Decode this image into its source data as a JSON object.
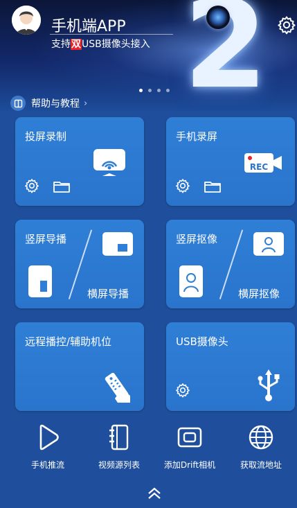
{
  "header": {
    "app_title": "手机端APP",
    "subtitle_prefix": "支持",
    "subtitle_highlight": "双",
    "subtitle_suffix": "USB摄像头接入",
    "banner_number": "2",
    "carousel": {
      "count": 4,
      "active_index": 0
    }
  },
  "help": {
    "label": "帮助与教程",
    "chevron": "›"
  },
  "cards": {
    "screen_record": {
      "title": "投屏录制",
      "icons": [
        "cast-icon",
        "gear-icon",
        "folder-icon"
      ]
    },
    "phone_record": {
      "title": "手机录屏",
      "rec_text": "REC",
      "icons": [
        "rec-camera-icon",
        "gear-icon",
        "folder-icon"
      ]
    },
    "broadcast": {
      "portrait": "竖屏导播",
      "landscape": "横屏导播"
    },
    "capture": {
      "portrait": "竖屏抠像",
      "landscape": "横屏抠像"
    },
    "remote": {
      "title": "远程播控/辅助机位",
      "icons": [
        "remote-control-icon"
      ]
    },
    "usb_camera": {
      "title": "USB摄像头",
      "icons": [
        "gear-icon",
        "usb-icon"
      ]
    }
  },
  "bottom_nav": {
    "push": "手机推流",
    "sources": "视频源列表",
    "drift": "添加Drift相机",
    "stream_url": "获取流地址"
  },
  "colors": {
    "card": "#2f7fd6",
    "background": "#1f4f9c",
    "highlight": "#e8232b"
  }
}
